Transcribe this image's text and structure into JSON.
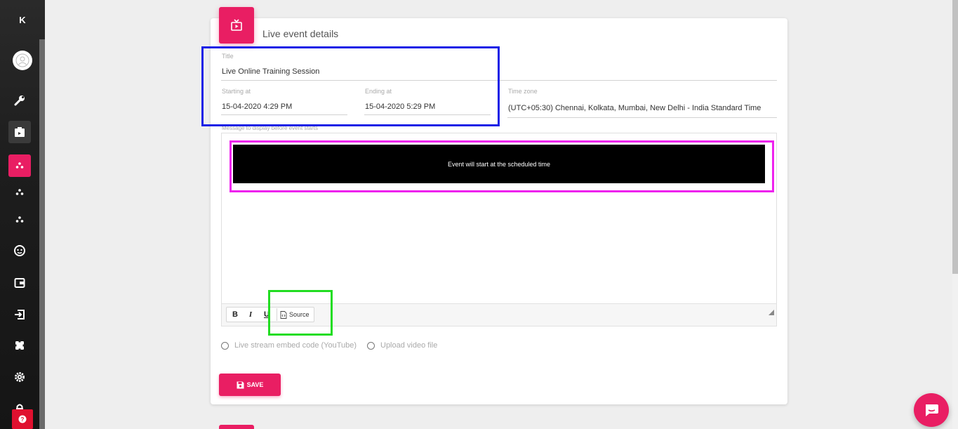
{
  "sidebar": {
    "brand": "K",
    "items": [
      {
        "icon": "wrench-icon"
      },
      {
        "icon": "clipboard-icon"
      },
      {
        "icon": "dots-icon",
        "active": true
      },
      {
        "icon": "dots-icon"
      },
      {
        "icon": "dots-icon"
      },
      {
        "icon": "face-icon"
      },
      {
        "icon": "wallet-icon"
      },
      {
        "icon": "login-icon"
      },
      {
        "icon": "puzzle-icon"
      },
      {
        "icon": "gear-icon"
      },
      {
        "icon": "lock-icon"
      }
    ],
    "help_label": "?"
  },
  "card": {
    "title": "Live event details",
    "fields": {
      "title_label": "Title",
      "title_value": "Live Online Training Session",
      "start_label": "Starting at",
      "start_value": "15-04-2020 4:29 PM",
      "end_label": "Ending at",
      "end_value": "15-04-2020 5:29 PM",
      "tz_label": "Time zone",
      "tz_value": "(UTC+05:30) Chennai, Kolkata, Mumbai, New Delhi - India Standard Time",
      "message_label": "Message to display before event starts"
    },
    "editor": {
      "banner_text": "Event will start at the scheduled time",
      "bold": "B",
      "italic": "I",
      "underline": "U",
      "source": "Source"
    },
    "options": {
      "youtube": "Live stream embed code (YouTube)",
      "upload": "Upload video file"
    },
    "save_label": "SAVE"
  },
  "colors": {
    "accent": "#e91e63",
    "annotation_blue": "#1a22e6",
    "annotation_magenta": "#ee22ee",
    "annotation_green": "#22dd22"
  }
}
